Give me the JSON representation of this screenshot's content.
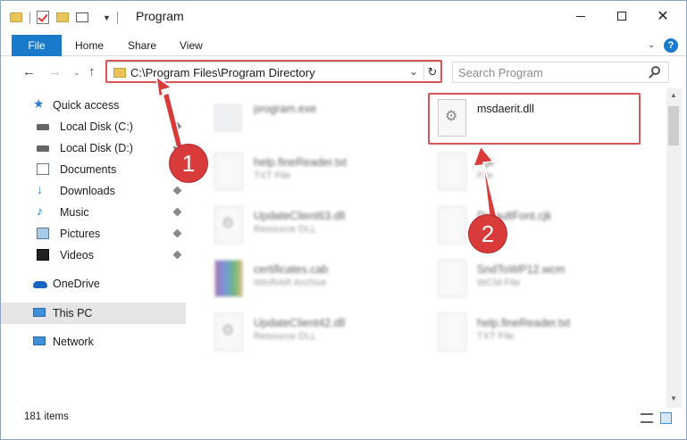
{
  "window": {
    "title": "Program",
    "min_label": "—",
    "close_label": "✕"
  },
  "ribbon": {
    "tabs": [
      {
        "label": "File"
      },
      {
        "label": "Home"
      },
      {
        "label": "Share"
      },
      {
        "label": "View"
      }
    ],
    "help_label": "?"
  },
  "address": {
    "path": "C:\\Program Files\\Program Directory"
  },
  "search": {
    "placeholder": "Search Program"
  },
  "nav_pane": {
    "items": [
      {
        "label": "Quick access"
      },
      {
        "label": "Local Disk (C:)"
      },
      {
        "label": "Local Disk (D:)"
      },
      {
        "label": "Documents"
      },
      {
        "label": "Downloads"
      },
      {
        "label": "Music"
      },
      {
        "label": "Pictures"
      },
      {
        "label": "Videos"
      },
      {
        "label": "OneDrive"
      },
      {
        "label": "This PC"
      },
      {
        "label": "Network"
      }
    ]
  },
  "files": {
    "items": [
      {
        "name": "program.exe",
        "type": ""
      },
      {
        "name": "msdaerit.dll",
        "type": ""
      },
      {
        "name": "help.fineReader.txt",
        "type": "TXT File"
      },
      {
        "name": ".cjk",
        "type": "File"
      },
      {
        "name": "UpdateClient63.dll",
        "type": "Resource DLL"
      },
      {
        "name": "DefaultFont.cjk",
        "type": ""
      },
      {
        "name": "certificates.cab",
        "type": "WinRAR Archive"
      },
      {
        "name": "SndToWP12.wcm",
        "type": "WCM File"
      },
      {
        "name": "UpdateClient42.dll",
        "type": "Resource DLL"
      },
      {
        "name": "help.fineReader.txt",
        "type": "TXT File"
      }
    ]
  },
  "status": {
    "item_count": "181 items"
  },
  "annotations": {
    "callout_1": "1",
    "callout_2": "2",
    "color": "#d93a3a"
  }
}
